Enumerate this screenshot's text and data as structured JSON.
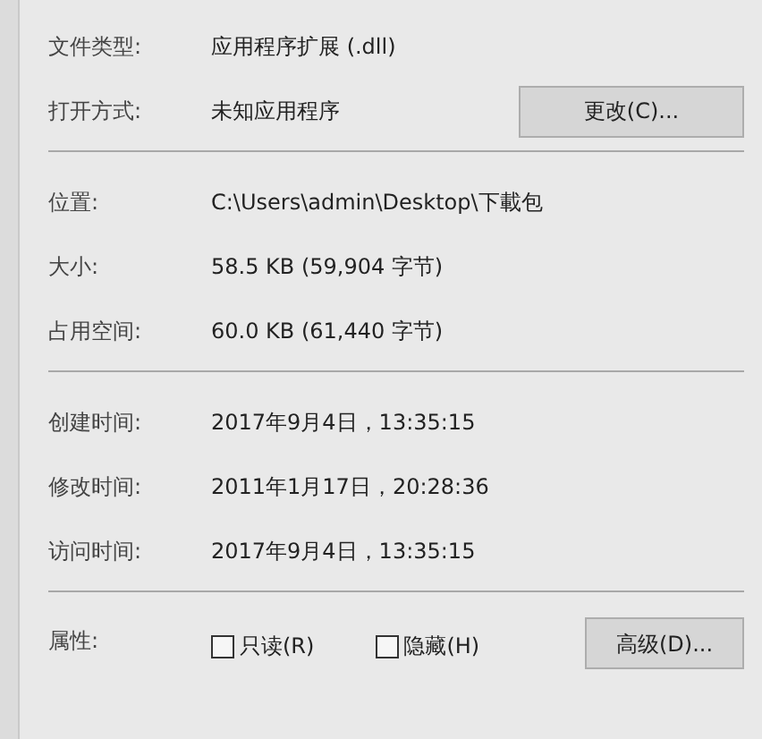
{
  "sections": [
    {
      "rows": [
        {
          "label": "文件类型:",
          "value": "应用程序扩展 (.dll)"
        },
        {
          "label": "打开方式:",
          "value": "未知应用程序",
          "button": "更改(C)..."
        }
      ]
    },
    {
      "rows": [
        {
          "label": "位置:",
          "value": "C:\\Users\\admin\\Desktop\\下載包"
        },
        {
          "label": "大小:",
          "value": "58.5 KB (59,904 字节)"
        },
        {
          "label": "占用空间:",
          "value": "60.0 KB (61,440 字节)"
        }
      ]
    },
    {
      "rows": [
        {
          "label": "创建时间:",
          "value": "2017年9月4日，13:35:15"
        },
        {
          "label": "修改时间:",
          "value": "2011年1月17日，20:28:36"
        },
        {
          "label": "访问时间:",
          "value": "2017年9月4日，13:35:15"
        }
      ]
    }
  ],
  "attributes": {
    "label": "属性:",
    "checkboxes": [
      {
        "label": "只读(R)",
        "checked": false
      },
      {
        "label": "隐藏(H)",
        "checked": false
      }
    ],
    "button": "高级(D)..."
  }
}
